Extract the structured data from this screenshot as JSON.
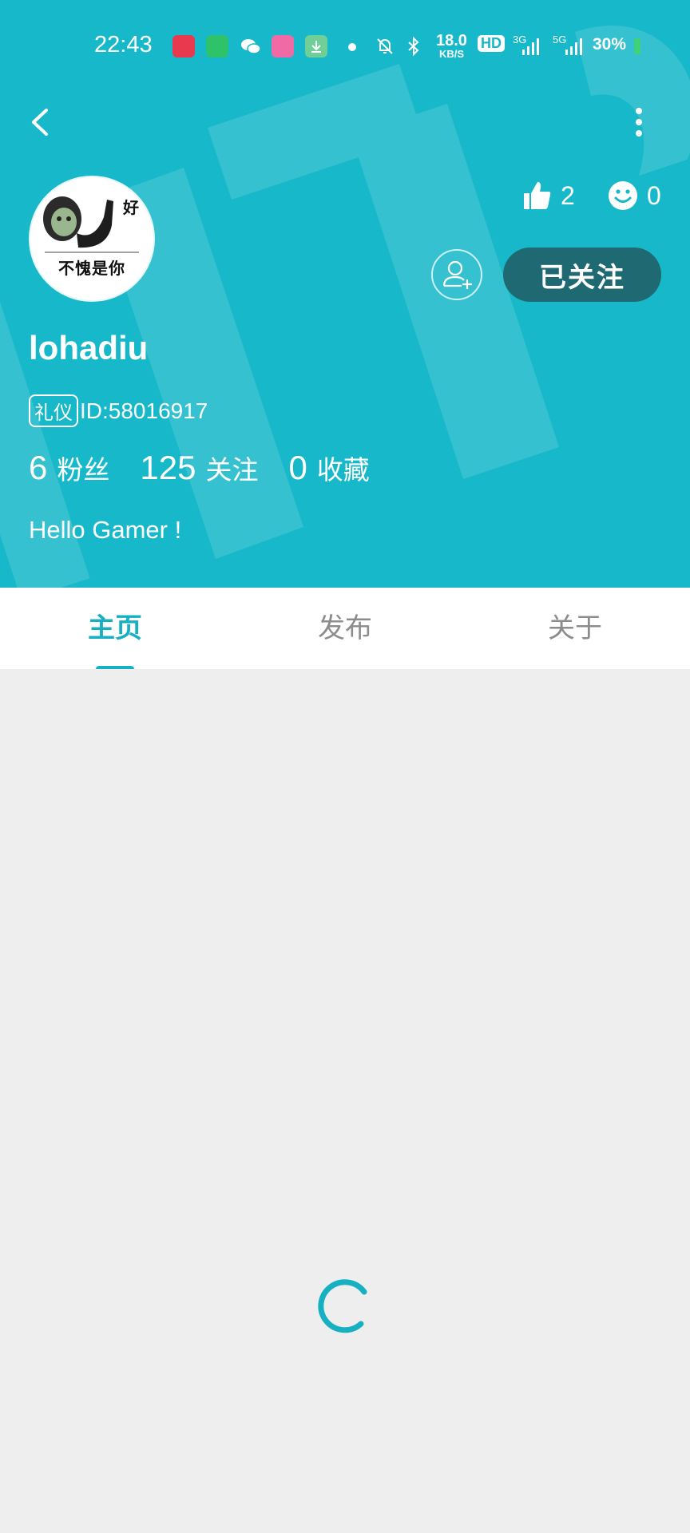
{
  "status_bar": {
    "time": "22:43",
    "speed_value": "18.0",
    "speed_unit": "KB/S",
    "hd_label": "HD",
    "network_3g": "3G",
    "network_5g": "5G",
    "battery": "30%",
    "icons": [
      "screen-record-icon",
      "app-green-icon",
      "wechat-icon",
      "bilibili-icon",
      "download-icon",
      "dot-icon",
      "bell-off-icon",
      "bluetooth-icon",
      "hd-icon",
      "signal-3g-icon",
      "signal-5g-icon",
      "battery-icon"
    ]
  },
  "profile": {
    "avatar_caption": "不愧是你",
    "avatar_corner_text": "好",
    "likes": "2",
    "smiles": "0",
    "follow_button": "已关注",
    "username": "lohadiu",
    "badge": "礼仪",
    "id_text": "ID:58016917",
    "stats": [
      {
        "num": "6",
        "label": "粉丝"
      },
      {
        "num": "125",
        "label": "关注"
      },
      {
        "num": "0",
        "label": "收藏"
      }
    ],
    "bio": "Hello Gamer !"
  },
  "tabs": [
    {
      "label": "主页",
      "active": true
    },
    {
      "label": "发布",
      "active": false
    },
    {
      "label": "关于",
      "active": false
    }
  ],
  "colors": {
    "header_bg": "#17b8c9",
    "accent": "#17b0c2",
    "follow_btn": "#1f6a72",
    "page_bg": "#eeeeee"
  }
}
